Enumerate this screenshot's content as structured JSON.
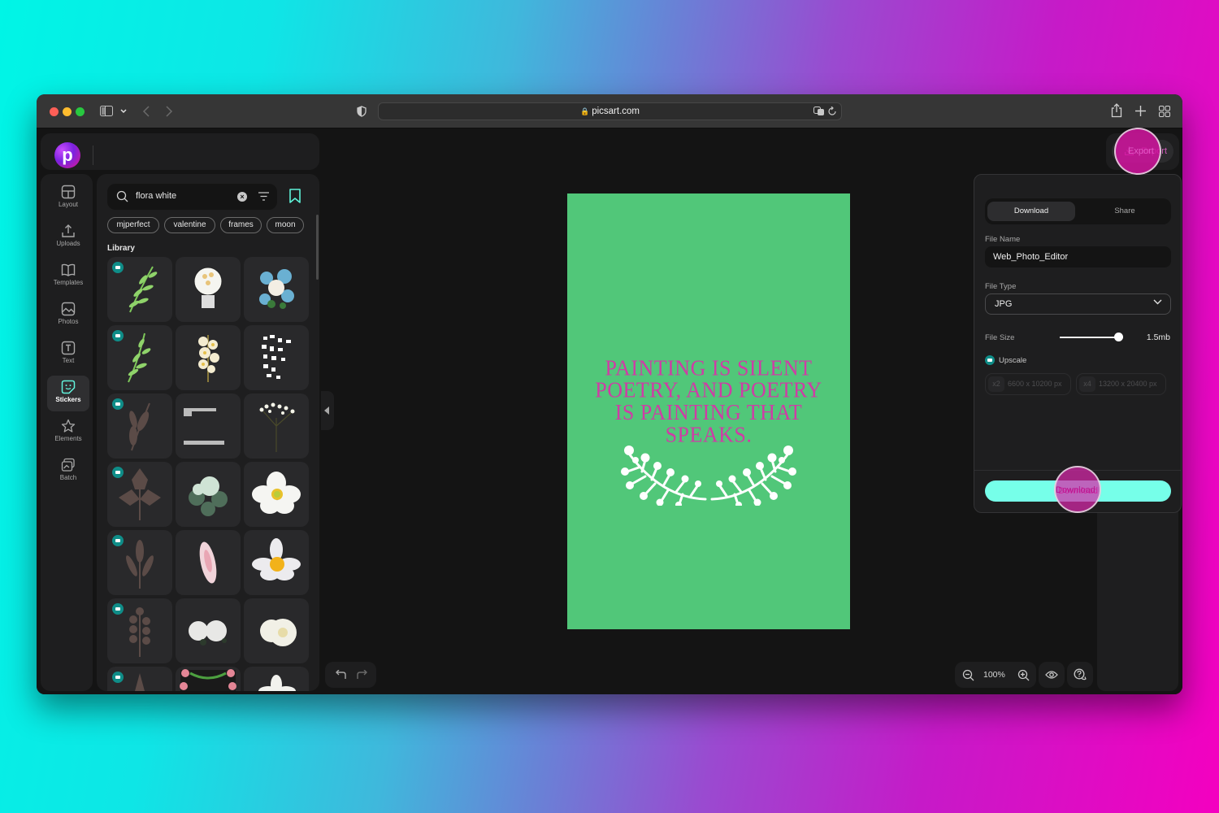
{
  "browser": {
    "url": "picsart.com",
    "traffic_lights": [
      "close",
      "minimize",
      "zoom"
    ],
    "icons": [
      "sidebar-icon",
      "chevron-down-icon",
      "back-icon",
      "forward-icon",
      "shield-icon",
      "translate-icon",
      "reload-icon",
      "share-icon",
      "new-tab-icon",
      "tab-overview-icon"
    ]
  },
  "app": {
    "logo_letter": "p",
    "nav": [
      {
        "label": "Layout",
        "icon": "layout-icon",
        "active": false
      },
      {
        "label": "Uploads",
        "icon": "upload-icon",
        "active": false
      },
      {
        "label": "Templates",
        "icon": "book-icon",
        "active": false
      },
      {
        "label": "Photos",
        "icon": "image-icon",
        "active": false
      },
      {
        "label": "Text",
        "icon": "text-icon",
        "active": false
      },
      {
        "label": "Stickers",
        "icon": "sticker-icon",
        "active": true
      },
      {
        "label": "Elements",
        "icon": "star-icon",
        "active": false
      },
      {
        "label": "Batch",
        "icon": "batch-icon",
        "active": false
      }
    ],
    "panel": {
      "search_value": "flora white",
      "chips": [
        "mjperfect",
        "valentine",
        "frames",
        "moon"
      ],
      "library_label": "Library",
      "stickers": [
        {
          "name": "green-leafy-branch",
          "premium": true
        },
        {
          "name": "flower-lightbulb",
          "premium": false
        },
        {
          "name": "blue-white-bouquet",
          "premium": false
        },
        {
          "name": "green-leafy-branch-2",
          "premium": true
        },
        {
          "name": "cream-blossom-branch",
          "premium": false
        },
        {
          "name": "white-petal-scatter",
          "premium": false
        },
        {
          "name": "brown-leaf-sprig",
          "premium": true
        },
        {
          "name": "floral-lace-borders",
          "premium": false
        },
        {
          "name": "babys-breath",
          "premium": false
        },
        {
          "name": "brown-maple-leaf",
          "premium": true
        },
        {
          "name": "pale-peony-bouquet",
          "premium": false
        },
        {
          "name": "white-anemone",
          "premium": false
        },
        {
          "name": "brown-tall-leaf",
          "premium": true
        },
        {
          "name": "pink-feather",
          "premium": false
        },
        {
          "name": "white-water-lily",
          "premium": false
        },
        {
          "name": "brown-fern-sprig",
          "premium": true
        },
        {
          "name": "white-gardenias",
          "premium": false
        },
        {
          "name": "white-rose",
          "premium": false
        },
        {
          "name": "brown-spike",
          "premium": true
        },
        {
          "name": "rose-frame",
          "premium": false
        },
        {
          "name": "white-lily",
          "premium": false
        }
      ]
    },
    "canvas": {
      "background": "#51c779",
      "quote": "PAINTING IS SILENT POETRY, AND POETRY IS PAINTING THAT SPEAKS.",
      "quote_color": "#cf3ca6",
      "ornament": "white-laurel-wreath"
    },
    "zoom": {
      "value": "100%"
    },
    "export": {
      "button_label": "Export",
      "tabs": [
        {
          "label": "Download",
          "active": true
        },
        {
          "label": "Share",
          "active": false
        }
      ],
      "file_name_label": "File Name",
      "file_name": "Web_Photo_Editor",
      "file_type_label": "File Type",
      "file_type": "JPG",
      "file_size_label": "File Size",
      "file_size": "1.5mb",
      "file_size_slider_fraction": 0.93,
      "upscale_label": "Upscale",
      "upscale_options": [
        {
          "multiplier": "x2",
          "size": "6600 x 10200 px"
        },
        {
          "multiplier": "x4",
          "size": "13200 x 20400 px"
        }
      ],
      "download_label": "Download",
      "accent": "#76ffe9"
    }
  }
}
